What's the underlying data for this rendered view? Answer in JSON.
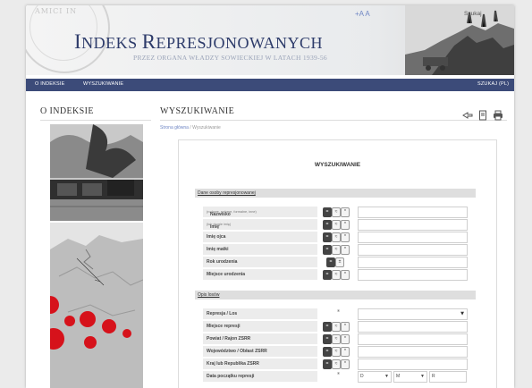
{
  "header": {
    "title_cap1": "I",
    "title_rest1": "NDEKS ",
    "title_cap2": "R",
    "title_rest2": "EPRESJONOWANYCH",
    "subtitle": "PRZEZ ORGANA WŁADZY SOWIECKIEJ W LATACH 1939-56",
    "font_size_control": "+A A",
    "top_right_link": "Szukaj",
    "seal_text": "AMICI IN"
  },
  "nav": {
    "items": [
      "O INDEKSIE",
      "WYSZUKIWANIE"
    ],
    "right": "SZUKAJ (PL)"
  },
  "sidebar": {
    "title": "O INDEKSIE"
  },
  "content": {
    "title": "WYSZUKIWANIE",
    "breadcrumb_home": "Strona główna",
    "breadcrumb_sep": " / ",
    "breadcrumb_current": "Wyszukiwanie"
  },
  "form": {
    "heading": "WYSZUKIWANIE",
    "section1": "Dane osoby represjonowanej",
    "fields1": [
      {
        "label": "Nazwisko",
        "hint": "(rodowe, rodowe, formalne, inne)"
      },
      {
        "label": "Imię",
        "hint": "(lub drugie imię)"
      },
      {
        "label": "Imię ojca",
        "hint": ""
      },
      {
        "label": "Imię matki",
        "hint": ""
      },
      {
        "label": "Rok urodzenia",
        "hint": ""
      },
      {
        "label": "Miejsce urodzenia",
        "hint": ""
      }
    ],
    "section2": "Opis losów",
    "fields2": [
      {
        "label": "Represja / Los"
      },
      {
        "label": "Miejsce represji"
      },
      {
        "label": "Powiat / Rajon ZSRR"
      },
      {
        "label": "Województwo / Obłast ZSRR"
      },
      {
        "label": "Kraj lub Republika ZSRR"
      },
      {
        "label": "Data początku represji"
      }
    ],
    "star": "*",
    "date_placeholders": [
      "D",
      "M",
      "R"
    ]
  },
  "colors": {
    "nav_bg": "#3c4b79",
    "title_color": "#2d3b6a",
    "link_color": "#6f86c4"
  }
}
